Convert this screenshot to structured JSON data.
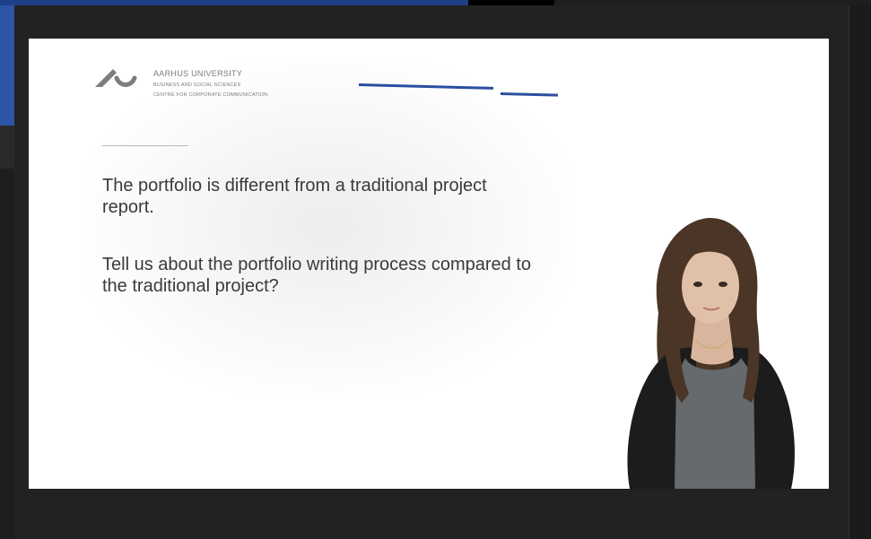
{
  "slide": {
    "logo": {
      "name": "AARHUS UNIVERSITY",
      "subline1": "BUSINESS AND SOCIAL SCIENCES",
      "subline2": "CENTRE FOR CORPORATE COMMUNICATION"
    },
    "question1": "The portfolio is different from a traditional project report.",
    "question2": "Tell us about the portfolio writing process compared to the traditional project?"
  },
  "colors": {
    "accent_blue": "#2a4fa0",
    "background_window_blue": "#2d55a8",
    "player_background": "#222222",
    "slide_background": "#ffffff"
  },
  "icons": [
    "aarhus-university-logo-icon"
  ]
}
